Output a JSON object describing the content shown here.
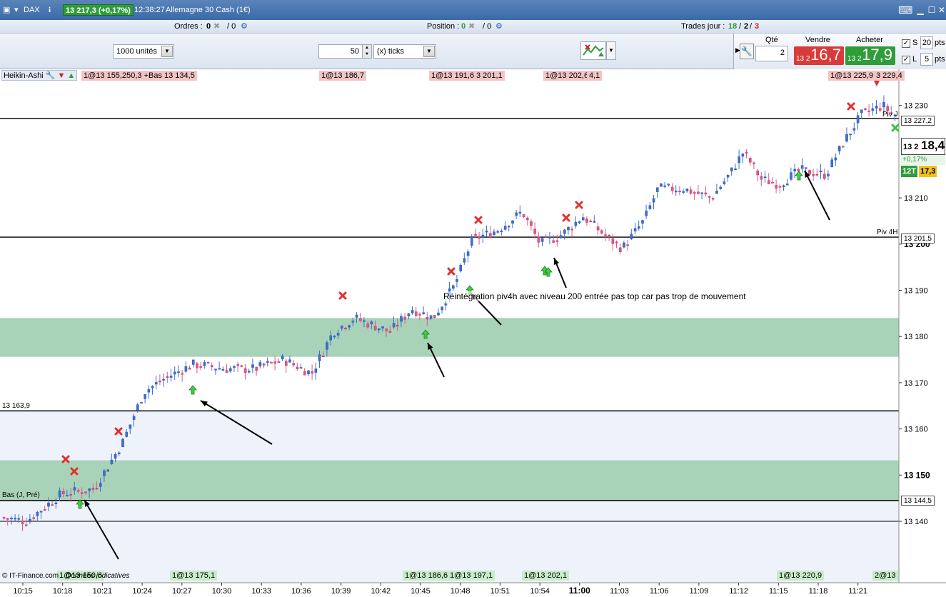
{
  "titlebar": {
    "instrument": "DAX",
    "instrument_box": "13 217,3 (+0,17%)",
    "time": "12:38:27",
    "name": "Allemagne 30 Cash (1€)",
    "colors": {
      "bg": "#4574b1",
      "green": "#2f9c3a"
    }
  },
  "inforow": {
    "ordres_label": "Ordres :",
    "ordres_a": "0",
    "ordres_b": "/ 0",
    "position_label": "Position :",
    "position_a": "0",
    "position_b": "/ 0",
    "trades_label": "Trades jour :",
    "trades_green": "18",
    "trades_sep1": "/",
    "trades_black": "2",
    "trades_sep2": "/",
    "trades_red": "3"
  },
  "toolbar": {
    "units": "1000 unités",
    "ticks_value": "50",
    "ticks_unit": "(x) ticks"
  },
  "orderpanel": {
    "qte_label": "Qté",
    "qte_value": "2",
    "sell_label": "Vendre",
    "sell_small": "13 2",
    "sell_big": "16,7",
    "buy_label": "Acheter",
    "buy_small": "13 2",
    "buy_big": "17,9",
    "s_label": "S",
    "s_value": "20",
    "s_unit": "pts",
    "l_label": "L",
    "l_value": "5",
    "l_unit": "pts"
  },
  "chart": {
    "indicator_label": "Heikin-Ashi",
    "overlay_text": "1@13 155,250,3 +Bas 13 134,5",
    "annotation": "Réintégration piv4h avec niveau 200 entrée pas top car pas trop de mouvement",
    "copyright": "© IT-Finance.com",
    "indicative": "Données indicatives",
    "levels": [
      {
        "price": 13227.2,
        "label": "Piv J",
        "tag": "13 227,2"
      },
      {
        "price": 13201.5,
        "label": "Piv 4H",
        "tag": "13 201,5"
      },
      {
        "price": 13163.9,
        "label": "13 163,9",
        "tag": ""
      },
      {
        "price": 13144.5,
        "label": "Bas (J, Pré)",
        "tag": "13 144,5"
      }
    ],
    "zones": [
      {
        "from": 13175.6,
        "to": 13184.0
      },
      {
        "from": 13144.5,
        "to": 13153.2
      }
    ],
    "right_axis": {
      "ticks": [
        {
          "price": 13230,
          "label": "13 230",
          "bold": false
        },
        {
          "price": 13210,
          "label": "13 210",
          "bold": false
        },
        {
          "price": 13200,
          "label": "13 200",
          "bold": true
        },
        {
          "price": 13190,
          "label": "13 190",
          "bold": false
        },
        {
          "price": 13180,
          "label": "13 180",
          "bold": false
        },
        {
          "price": 13170,
          "label": "13 170",
          "bold": false
        },
        {
          "price": 13160,
          "label": "13 160",
          "bold": false
        },
        {
          "price": 13150,
          "label": "13 150",
          "bold": true
        },
        {
          "price": 13140,
          "label": "13 140",
          "bold": false
        }
      ],
      "price_small": "13 2",
      "price_big": "18,4",
      "change": "+0,17%",
      "tag_12t": "12T",
      "tag_173": "17,3"
    },
    "time_axis": [
      {
        "label": "10:15",
        "bold": false
      },
      {
        "label": "10:18",
        "bold": false
      },
      {
        "label": "10:21",
        "bold": false
      },
      {
        "label": "10:24",
        "bold": false
      },
      {
        "label": "10:27",
        "bold": false
      },
      {
        "label": "10:30",
        "bold": false
      },
      {
        "label": "10:33",
        "bold": false
      },
      {
        "label": "10:36",
        "bold": false
      },
      {
        "label": "10:39",
        "bold": false
      },
      {
        "label": "10:42",
        "bold": false
      },
      {
        "label": "10:45",
        "bold": false
      },
      {
        "label": "10:48",
        "bold": false
      },
      {
        "label": "10:51",
        "bold": false
      },
      {
        "label": "10:54",
        "bold": false
      },
      {
        "label": "11:00",
        "bold": true
      },
      {
        "label": "11:03",
        "bold": false
      },
      {
        "label": "11:06",
        "bold": false
      },
      {
        "label": "11:09",
        "bold": false
      },
      {
        "label": "11:12",
        "bold": false
      },
      {
        "label": "11:15",
        "bold": false
      },
      {
        "label": "11:18",
        "bold": false
      },
      {
        "label": "11:21",
        "bold": false
      }
    ],
    "top_tags": [
      "1@13 186,7",
      "1@13 191,6",
      "3 201,1",
      "1@13 202,6",
      "4,1",
      "1@13 225,9",
      "3 229,4"
    ],
    "bottom_tags": [
      "1@13 150,6",
      "1@13 175,1",
      "1@13 186,6",
      "1@13 197,1",
      "1@13 202,1",
      "1@13 220,9",
      "2@13"
    ],
    "colors": {
      "bull": "#3d6fcf",
      "bear": "#e0588a",
      "zone": "#a9d3b8",
      "bg_band": "#eef2fb"
    }
  }
}
